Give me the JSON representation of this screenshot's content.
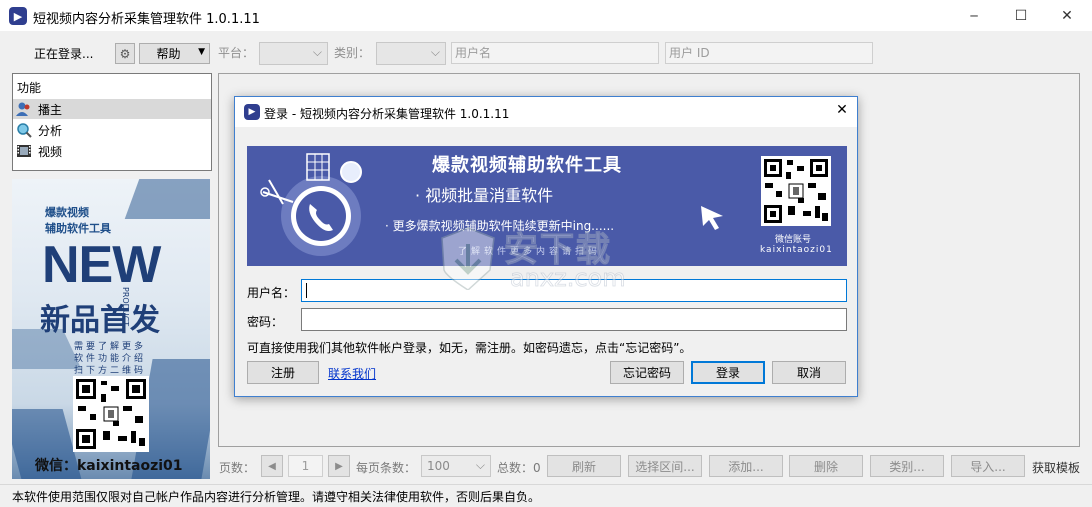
{
  "window": {
    "title": "短视频内容分析采集管理软件 1.0.1.11",
    "minimize": "─",
    "maximize": "☐",
    "close": "✕"
  },
  "toolbar": {
    "status": "正在登录...",
    "help": "帮助",
    "platform_label": "平台：",
    "category_label": "类别：",
    "username_placeholder": "用户名",
    "userid_placeholder": "用户 ID"
  },
  "nav": {
    "header": "功能",
    "items": [
      {
        "label": "播主",
        "icon": "user-icon",
        "selected": true
      },
      {
        "label": "分析",
        "icon": "magnifier-icon",
        "selected": false
      },
      {
        "label": "视频",
        "icon": "film-icon",
        "selected": false
      }
    ]
  },
  "ad": {
    "line1": "爆款视频",
    "line2": "辅助软件工具",
    "new": "NEW",
    "product": "PRODUCT",
    "slogan": "新品首发",
    "info1": "需要了解更多",
    "info2": "软件功能介绍",
    "info3": "扫下方二维码",
    "wechat": "微信：kaixintaozi01"
  },
  "dialog": {
    "title": "登录 - 短视频内容分析采集管理软件 1.0.1.11",
    "banner": {
      "headline": "爆款视频辅助软件工具",
      "line1": "· 视频批量消重软件",
      "line2": "· 更多爆款视频辅助软件陆续更新中ing......",
      "tagline": "了解软件更多内容请扫码",
      "qr_caption1": "微信账号",
      "qr_caption2": "kaixintaozi01"
    },
    "username_label": "用户名：",
    "username_value": "",
    "password_label": "密码：",
    "password_value": "",
    "hint": "可直接使用我们其他软件帐户登录，如无，需注册。如密码遗忘，点击“忘记密码”。",
    "register": "注册",
    "contact": "联系我们",
    "forgot": "忘记密码",
    "login": "登录",
    "cancel": "取消"
  },
  "watermark": {
    "brand": "安下载",
    "url": "anxz.com"
  },
  "pager": {
    "pages_label": "页数：",
    "page": "1",
    "per_page_label": "每页条数：",
    "per_page": "100",
    "total": "总数：0",
    "refresh": "刷新",
    "range": "选择区间...",
    "add": "添加...",
    "delete": "删除",
    "category": "类别...",
    "import": "导入...",
    "template": "获取模板"
  },
  "status_bar": "本软件使用范围仅限对自己帐户作品内容进行分析管理。请遵守相关法律使用软件，否则后果自负。"
}
